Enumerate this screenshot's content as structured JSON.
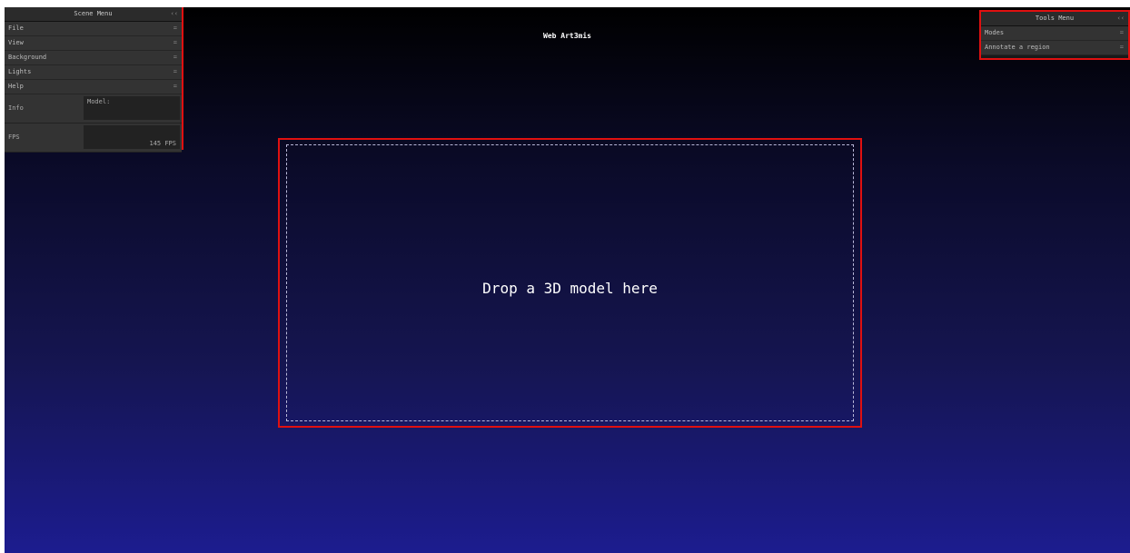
{
  "app_title": "Web Art3mis",
  "scene_menu": {
    "title": "Scene Menu",
    "collapse_icon": "‹‹",
    "items": [
      {
        "label": "File",
        "icon": "="
      },
      {
        "label": "View",
        "icon": "="
      },
      {
        "label": "Background",
        "icon": "="
      },
      {
        "label": "Lights",
        "icon": "="
      },
      {
        "label": "Help",
        "icon": "="
      }
    ],
    "info_label": "Info",
    "info_value": "Model:",
    "fps_label": "FPS",
    "fps_value": "145 FPS"
  },
  "tools_menu": {
    "title": "Tools Menu",
    "collapse_icon": "‹‹",
    "items": [
      {
        "label": "Modes",
        "icon": "="
      },
      {
        "label": "Annotate a region",
        "icon": "="
      }
    ]
  },
  "dropzone": {
    "text": "Drop a 3D model here"
  }
}
